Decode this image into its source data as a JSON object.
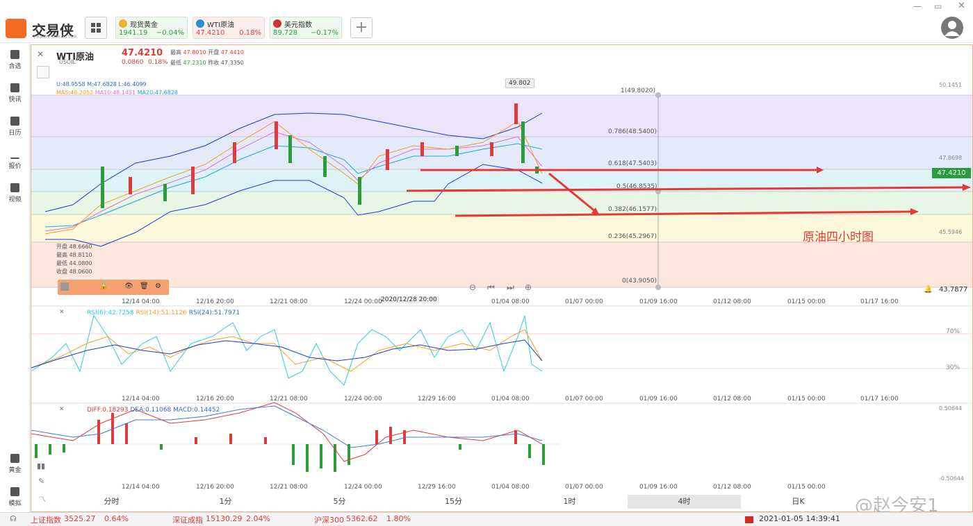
{
  "app": {
    "name": "交易侠",
    "sub": "TRADER MASTER"
  },
  "quotes": [
    {
      "name": "现货黄金",
      "price": "1941.19",
      "change": "−0.04%",
      "color": "#2a9d3a"
    },
    {
      "name": "WTI原油",
      "price": "47.4210",
      "change": "0.18%",
      "color": "#e03b3b"
    },
    {
      "name": "美元指数",
      "price": "89.728",
      "change": "−0.17%",
      "color": "#2a9d3a"
    }
  ],
  "sidebar": [
    {
      "label": "合选",
      "icon": "star-list-icon"
    },
    {
      "label": "快讯",
      "icon": "news-icon"
    },
    {
      "label": "日历",
      "icon": "calendar-icon"
    },
    {
      "label": "报价",
      "icon": "chart-line-icon"
    },
    {
      "label": "视频",
      "icon": "video-icon"
    },
    {
      "label": "黄金",
      "icon": "gold-icon"
    },
    {
      "label": "模拟",
      "icon": "wallet-icon"
    }
  ],
  "symbol": {
    "name": "WTI原油",
    "code": "USOIL",
    "price": "47.4210",
    "change": "0.0860",
    "pct": "0.18%",
    "high_label": "最高",
    "high": "47.8010",
    "open_label": "开盘",
    "open": "47.4410",
    "low_label": "最低",
    "low": "47.2310",
    "prev_label": "昨收",
    "prev": "47.3350"
  },
  "indicators": {
    "boll": "U:48.9558  M:47.6828  L:46.4099",
    "ma5": "MA5:48.2052",
    "ma10": "MA10:48.1451",
    "ma20": "MA20:47.6828"
  },
  "fib": [
    {
      "label": "1(49.8020)"
    },
    {
      "label": "0.786(48.5400)"
    },
    {
      "label": "0.618(47.5403)"
    },
    {
      "label": "0.5(46.8535)"
    },
    {
      "label": "0.382(46.1577)"
    },
    {
      "label": "0.236(45.2967)"
    },
    {
      "label": "0(43.9050)"
    }
  ],
  "price_axis": {
    "p1": "50.1451",
    "p2": "47.8698",
    "p3": "45.5946",
    "current": "47.4210",
    "bottom": "43.7877"
  },
  "peak_label": "49.802",
  "annotation": "原油四小时图",
  "ohlc_popup": {
    "open": "开盘 48.6660",
    "high": "最高 48.8110",
    "low": "最低 44.0800",
    "close": "收盘 48.0600"
  },
  "crosshair_time": "2020/12/28 20:00",
  "x_labels": [
    "12/14 04:00",
    "12/16 20:00",
    "12/21 08:00",
    "12/24 00:00",
    "12/29 16:00",
    "01/04 08:00",
    "01/07 00:00",
    "01/09 16:00",
    "01/12 08:00",
    "01/15 00:00",
    "01/17 16:00"
  ],
  "rsi": {
    "r6": "RSI(6):42.7258",
    "r14": "RSI(14):51.1126",
    "r24": "RSI(24):51.7971",
    "l70": "70%",
    "l30": "30%"
  },
  "macd": {
    "diff": "DIFF:0.18293",
    "dea": "DEA:0.11068",
    "macd": "MACD:0.14452",
    "top": "0.50644",
    "bottom": "-0.50644"
  },
  "timeframes": [
    "分时",
    "1分",
    "5分",
    "15分",
    "1时",
    "4时",
    "日K"
  ],
  "status": {
    "sh": "上证指数",
    "sh_v": "3525.27",
    "sh_c": "0.64%",
    "sz": "深证成指",
    "sz_v": "15130.29",
    "sz_c": "2.04%",
    "hs": "沪深300",
    "hs_v": "5362.62",
    "hs_c": "1.80%",
    "time": "2021-01-05 14:39:41"
  },
  "watermark": "@赵今安1"
}
